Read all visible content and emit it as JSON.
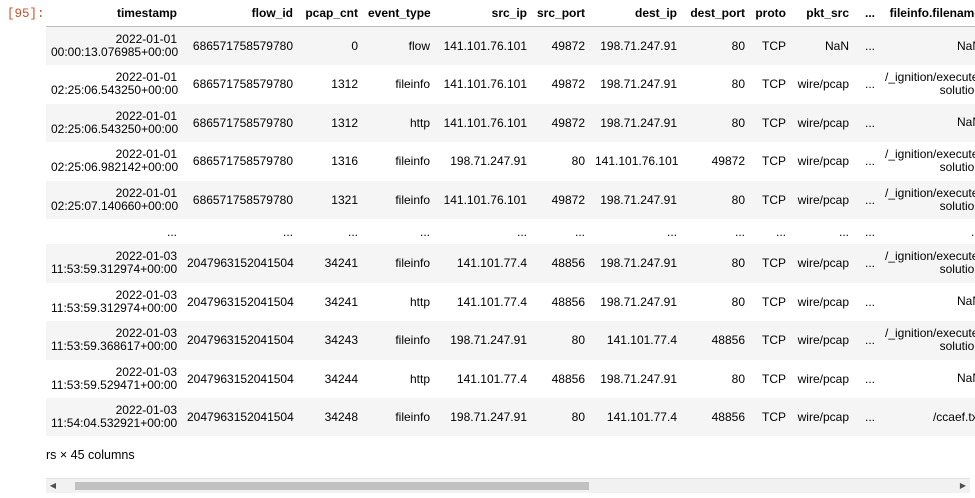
{
  "prompt_label": "[95]:",
  "columns": [
    "timestamp",
    "flow_id",
    "pcap_cnt",
    "event_type",
    "src_ip",
    "src_port",
    "dest_ip",
    "dest_port",
    "proto",
    "pkt_src",
    "...",
    "fileinfo.filename"
  ],
  "rows": [
    {
      "ts_date": "2022-01-01",
      "ts_time": "00:00:13.076985+00:00",
      "flow_id": "686571758579780",
      "pcap_cnt": "0",
      "event_type": "flow",
      "src_ip": "141.101.76.101",
      "src_port": "49872",
      "dest_ip": "198.71.247.91",
      "dest_port": "80",
      "proto": "TCP",
      "pkt_src": "NaN",
      "more": "...",
      "filename": "NaN"
    },
    {
      "ts_date": "2022-01-01",
      "ts_time": "02:25:06.543250+00:00",
      "flow_id": "686571758579780",
      "pcap_cnt": "1312",
      "event_type": "fileinfo",
      "src_ip": "141.101.76.101",
      "src_port": "49872",
      "dest_ip": "198.71.247.91",
      "dest_port": "80",
      "proto": "TCP",
      "pkt_src": "wire/pcap",
      "more": "...",
      "filename": "/_ignition/execute-solution"
    },
    {
      "ts_date": "2022-01-01",
      "ts_time": "02:25:06.543250+00:00",
      "flow_id": "686571758579780",
      "pcap_cnt": "1312",
      "event_type": "http",
      "src_ip": "141.101.76.101",
      "src_port": "49872",
      "dest_ip": "198.71.247.91",
      "dest_port": "80",
      "proto": "TCP",
      "pkt_src": "wire/pcap",
      "more": "...",
      "filename": "NaN"
    },
    {
      "ts_date": "2022-01-01",
      "ts_time": "02:25:06.982142+00:00",
      "flow_id": "686571758579780",
      "pcap_cnt": "1316",
      "event_type": "fileinfo",
      "src_ip": "198.71.247.91",
      "src_port": "80",
      "dest_ip": "141.101.76.101",
      "dest_port": "49872",
      "proto": "TCP",
      "pkt_src": "wire/pcap",
      "more": "...",
      "filename": "/_ignition/execute-solution"
    },
    {
      "ts_date": "2022-01-01",
      "ts_time": "02:25:07.140660+00:00",
      "flow_id": "686571758579780",
      "pcap_cnt": "1321",
      "event_type": "fileinfo",
      "src_ip": "141.101.76.101",
      "src_port": "49872",
      "dest_ip": "198.71.247.91",
      "dest_port": "80",
      "proto": "TCP",
      "pkt_src": "wire/pcap",
      "more": "...",
      "filename": "/_ignition/execute-solution"
    },
    {
      "ellipsis": true,
      "cell": "..."
    },
    {
      "ts_date": "2022-01-03",
      "ts_time": "11:53:59.312974+00:00",
      "flow_id": "2047963152041504",
      "pcap_cnt": "34241",
      "event_type": "fileinfo",
      "src_ip": "141.101.77.4",
      "src_port": "48856",
      "dest_ip": "198.71.247.91",
      "dest_port": "80",
      "proto": "TCP",
      "pkt_src": "wire/pcap",
      "more": "...",
      "filename": "/_ignition/execute-solution"
    },
    {
      "ts_date": "2022-01-03",
      "ts_time": "11:53:59.312974+00:00",
      "flow_id": "2047963152041504",
      "pcap_cnt": "34241",
      "event_type": "http",
      "src_ip": "141.101.77.4",
      "src_port": "48856",
      "dest_ip": "198.71.247.91",
      "dest_port": "80",
      "proto": "TCP",
      "pkt_src": "wire/pcap",
      "more": "...",
      "filename": "NaN"
    },
    {
      "ts_date": "2022-01-03",
      "ts_time": "11:53:59.368617+00:00",
      "flow_id": "2047963152041504",
      "pcap_cnt": "34243",
      "event_type": "fileinfo",
      "src_ip": "198.71.247.91",
      "src_port": "80",
      "dest_ip": "141.101.77.4",
      "dest_port": "48856",
      "proto": "TCP",
      "pkt_src": "wire/pcap",
      "more": "...",
      "filename": "/_ignition/execute-solution"
    },
    {
      "ts_date": "2022-01-03",
      "ts_time": "11:53:59.529471+00:00",
      "flow_id": "2047963152041504",
      "pcap_cnt": "34244",
      "event_type": "http",
      "src_ip": "141.101.77.4",
      "src_port": "48856",
      "dest_ip": "198.71.247.91",
      "dest_port": "80",
      "proto": "TCP",
      "pkt_src": "wire/pcap",
      "more": "...",
      "filename": "NaN"
    },
    {
      "ts_date": "2022-01-03",
      "ts_time": "11:54:04.532921+00:00",
      "flow_id": "2047963152041504",
      "pcap_cnt": "34248",
      "event_type": "fileinfo",
      "src_ip": "198.71.247.91",
      "src_port": "80",
      "dest_ip": "141.101.77.4",
      "dest_port": "48856",
      "proto": "TCP",
      "pkt_src": "wire/pcap",
      "more": "...",
      "filename": "/ccaef.txt"
    }
  ],
  "footer_text": "rs × 45 columns",
  "scrollbar": {
    "left_arrow": "◀",
    "right_arrow": "▶",
    "position_fraction": 0.04
  }
}
